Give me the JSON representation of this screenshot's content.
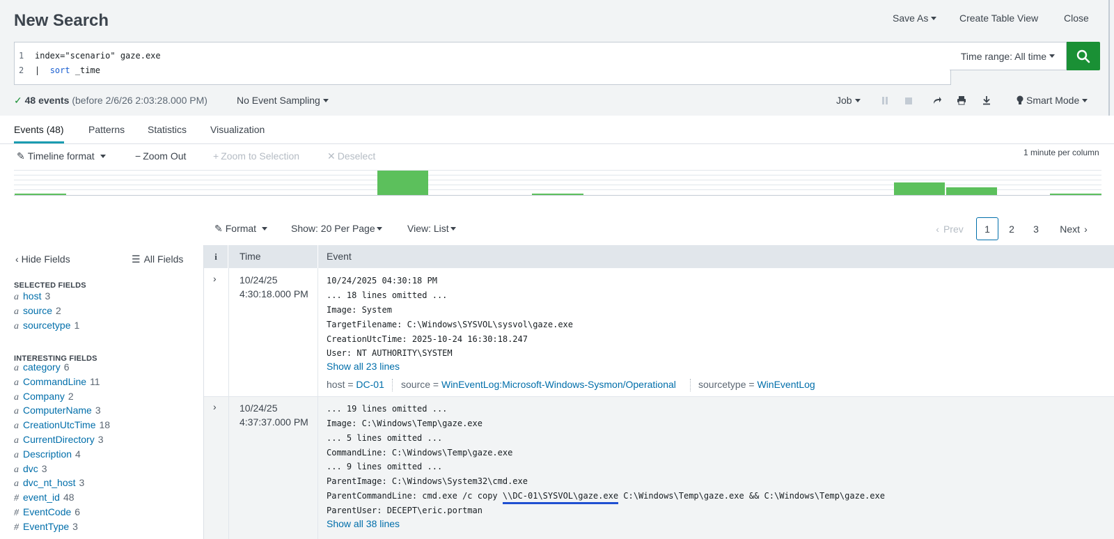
{
  "header": {
    "title": "New Search",
    "save_as": "Save As",
    "create_table_view": "Create Table View",
    "close": "Close"
  },
  "search": {
    "line_numbers": [
      "1",
      "2"
    ],
    "line1": "index=\"scenario\" gaze.exe",
    "line2_pipe": "|",
    "line2_cmd": "sort",
    "line2_arg": "_time",
    "time_range": "Time range: All time"
  },
  "status": {
    "events_count": "48 events",
    "events_before": "(before 2/6/26 2:03:28.000 PM)",
    "sampling": "No Event Sampling",
    "job": "Job",
    "mode": "Smart Mode"
  },
  "tabs": [
    "Events (48)",
    "Patterns",
    "Statistics",
    "Visualization"
  ],
  "timeline": {
    "format": "Timeline format",
    "zoom_out": "Zoom Out",
    "zoom_selection": "Zoom to Selection",
    "deselect": "Deselect",
    "scale": "1 minute per column"
  },
  "results_toolbar": {
    "format": "Format",
    "show": "Show: 20 Per Page",
    "view": "View: List",
    "prev": "Prev",
    "pages": [
      "1",
      "2",
      "3"
    ],
    "next": "Next"
  },
  "fields_panel": {
    "hide_fields": "Hide Fields",
    "all_fields": "All Fields",
    "selected_heading": "SELECTED FIELDS",
    "selected": [
      {
        "type": "a",
        "name": "host",
        "count": "3"
      },
      {
        "type": "a",
        "name": "source",
        "count": "2"
      },
      {
        "type": "a",
        "name": "sourcetype",
        "count": "1"
      }
    ],
    "interesting_heading": "INTERESTING FIELDS",
    "interesting": [
      {
        "type": "a",
        "name": "category",
        "count": "6"
      },
      {
        "type": "a",
        "name": "CommandLine",
        "count": "11"
      },
      {
        "type": "a",
        "name": "Company",
        "count": "2"
      },
      {
        "type": "a",
        "name": "ComputerName",
        "count": "3"
      },
      {
        "type": "a",
        "name": "CreationUtcTime",
        "count": "18"
      },
      {
        "type": "a",
        "name": "CurrentDirectory",
        "count": "3"
      },
      {
        "type": "a",
        "name": "Description",
        "count": "4"
      },
      {
        "type": "a",
        "name": "dvc",
        "count": "3"
      },
      {
        "type": "a",
        "name": "dvc_nt_host",
        "count": "3"
      },
      {
        "type": "#",
        "name": "event_id",
        "count": "48"
      },
      {
        "type": "#",
        "name": "EventCode",
        "count": "6"
      },
      {
        "type": "#",
        "name": "EventType",
        "count": "3"
      }
    ]
  },
  "table": {
    "col_info": "i",
    "col_time": "Time",
    "col_event": "Event"
  },
  "events": [
    {
      "date": "10/24/25",
      "time": "4:30:18.000 PM",
      "lines": [
        "10/24/2025 04:30:18 PM",
        "... 18 lines omitted ...",
        "Image: System",
        "TargetFilename: C:\\Windows\\SYSVOL\\sysvol\\gaze.exe",
        "CreationUtcTime: 2025-10-24 16:30:18.247",
        "User: NT AUTHORITY\\SYSTEM"
      ],
      "show_all": "Show all 23 lines",
      "meta": {
        "host_key": "host =",
        "host_val": "DC-01",
        "source_key": "source =",
        "source_val": "WinEventLog:Microsoft-Windows-Sysmon/Operational",
        "sourcetype_key": "sourcetype =",
        "sourcetype_val": "WinEventLog"
      }
    },
    {
      "date": "10/24/25",
      "time": "4:37:37.000 PM",
      "lines": [
        "... 19 lines omitted ...",
        "Image: C:\\Windows\\Temp\\gaze.exe",
        "... 5 lines omitted ...",
        "CommandLine: C:\\Windows\\Temp\\gaze.exe",
        "... 9 lines omitted ...",
        "ParentImage: C:\\Windows\\System32\\cmd.exe"
      ],
      "parent_cmd_prefix": "ParentCommandLine: cmd.exe /c copy ",
      "parent_cmd_highlight": "\\\\DC-01\\SYSVOL\\gaze.exe",
      "parent_cmd_suffix": " C:\\Windows\\Temp\\gaze.exe && C:\\Windows\\Temp\\gaze.exe",
      "parent_user": "ParentUser: DECEPT\\eric.portman",
      "show_all": "Show all 38 lines"
    }
  ],
  "colors": {
    "accent_green": "#1a9035",
    "timeline_green": "#5cc05c",
    "link_blue": "#006eaa",
    "highlight_underline": "#1f4fd1",
    "active_tab": "#1a9cb0"
  },
  "icons": [
    "search-icon",
    "check-icon",
    "pause-icon",
    "stop-icon",
    "share-icon",
    "print-icon",
    "download-icon",
    "bulb-icon",
    "pencil-icon",
    "list-icon",
    "chevron-left-icon",
    "chevron-right-icon",
    "expand-chevron-icon"
  ]
}
